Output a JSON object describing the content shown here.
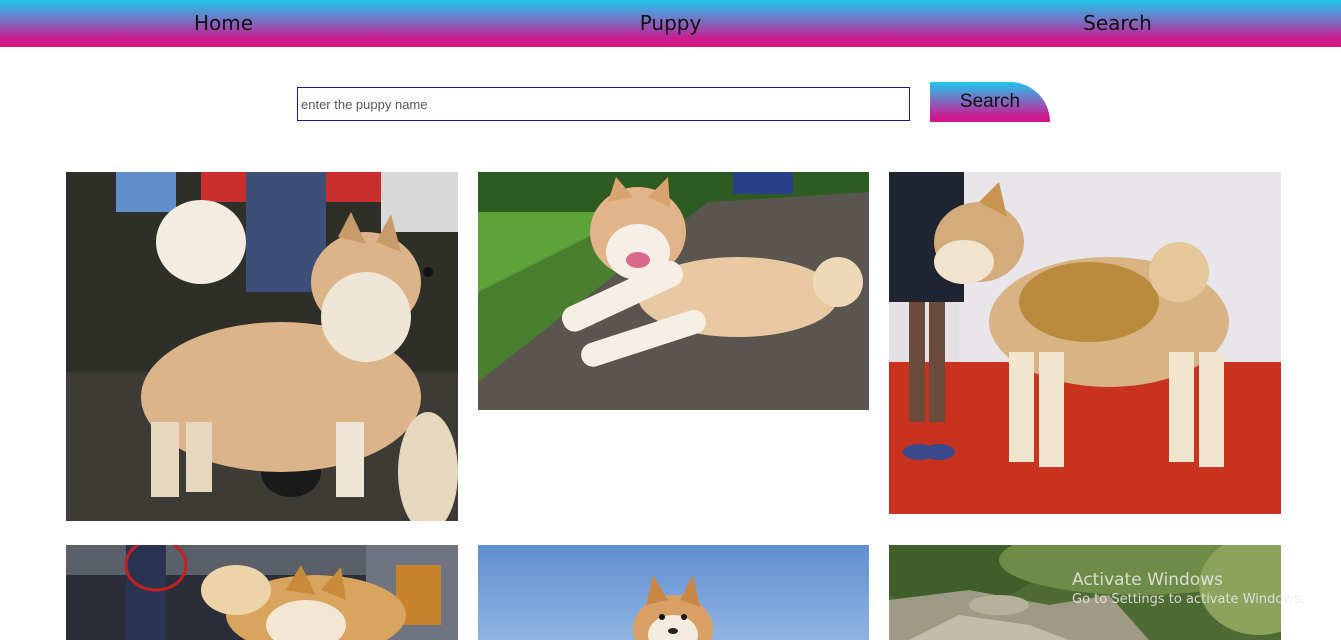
{
  "nav": {
    "items": [
      {
        "label": "Home"
      },
      {
        "label": "Puppy"
      },
      {
        "label": "Search"
      }
    ],
    "gradient_colors": [
      "#1fc6ec",
      "#7a6fc2",
      "#c71f92",
      "#d4147f"
    ]
  },
  "search": {
    "placeholder": "enter the puppy name",
    "value": "",
    "button_label": "Search"
  },
  "gallery": {
    "photos": [
      {
        "subject": "fluffy cream spitz dog standing on wet pavement"
      },
      {
        "subject": "akita dog lying on wooden deck beside grass"
      },
      {
        "subject": "red and white akita standing on red carpet"
      },
      {
        "subject": "akita dog at crowded outdoor show"
      },
      {
        "subject": "akita dog under blue sky"
      },
      {
        "subject": "rocky hillside with greenery"
      }
    ]
  },
  "watermark": {
    "title": "Activate Windows",
    "subtitle": "Go to Settings to activate Windows."
  }
}
